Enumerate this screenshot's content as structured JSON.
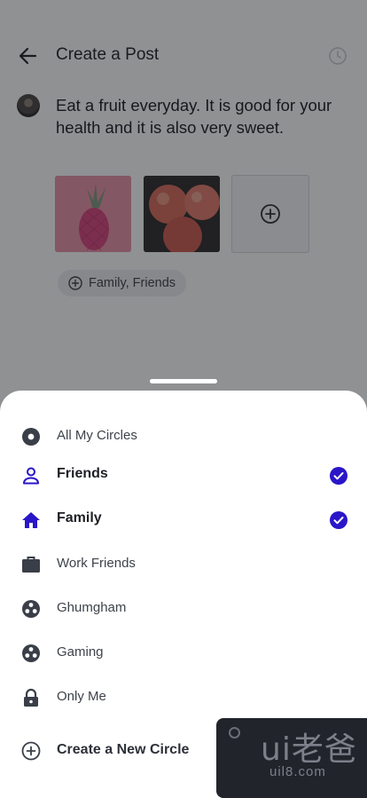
{
  "header": {
    "title": "Create a Post"
  },
  "post": {
    "text": "Eat a fruit everyday. It is good for your health and it is also very sweet.",
    "audience": "Family, Friends"
  },
  "sheet": {
    "items": [
      {
        "label": "All My Circles",
        "icon": "circle-dot-icon",
        "selected": false
      },
      {
        "label": "Friends",
        "icon": "person-icon",
        "selected": true
      },
      {
        "label": "Family",
        "icon": "home-icon",
        "selected": true
      },
      {
        "label": "Work Friends",
        "icon": "briefcase-icon",
        "selected": false
      },
      {
        "label": "Ghumgham",
        "icon": "group-icon",
        "selected": false
      },
      {
        "label": "Gaming",
        "icon": "group-icon",
        "selected": false
      },
      {
        "label": "Only Me",
        "icon": "lock-icon",
        "selected": false
      }
    ],
    "create_label": "Create a New Circle"
  },
  "watermark": {
    "brand": "ui老爸",
    "url": "uil8.com"
  },
  "colors": {
    "accent": "#2a16c8",
    "icon": "#3a3e48",
    "overlay": "rgba(20,22,26,0.47)"
  }
}
